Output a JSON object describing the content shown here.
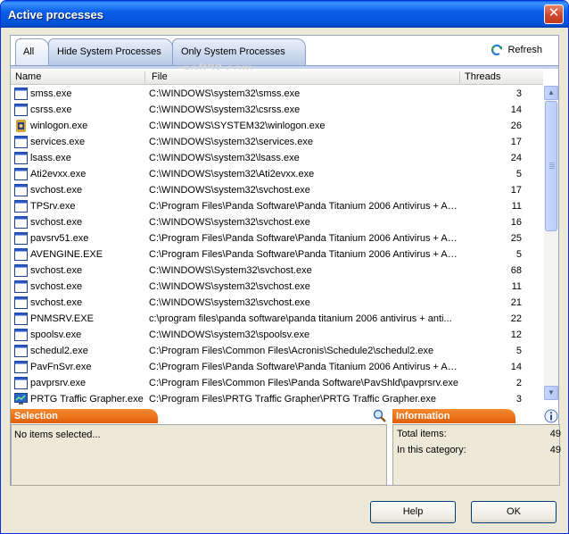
{
  "window": {
    "title": "Active processes",
    "close_glyph": "✕"
  },
  "tabs": [
    {
      "label": "All"
    },
    {
      "label": "Hide System Processes"
    },
    {
      "label": "Only System Processes"
    }
  ],
  "watermark": "soft32.com",
  "toolbar": {
    "refresh_label": "Refresh",
    "refresh_icon": "refresh-icon"
  },
  "columns": {
    "name": "Name",
    "file": "File",
    "threads": "Threads"
  },
  "processes": [
    {
      "name": "smss.exe",
      "file": "C:\\WINDOWS\\system32\\smss.exe",
      "threads": "3",
      "icon": "window-icon"
    },
    {
      "name": "csrss.exe",
      "file": "C:\\WINDOWS\\system32\\csrss.exe",
      "threads": "14",
      "icon": "window-icon"
    },
    {
      "name": "winlogon.exe",
      "file": "C:\\WINDOWS\\SYSTEM32\\winlogon.exe",
      "threads": "26",
      "icon": "winlogon-icon"
    },
    {
      "name": "services.exe",
      "file": "C:\\WINDOWS\\system32\\services.exe",
      "threads": "17",
      "icon": "window-icon"
    },
    {
      "name": "lsass.exe",
      "file": "C:\\WINDOWS\\system32\\lsass.exe",
      "threads": "24",
      "icon": "window-icon"
    },
    {
      "name": "Ati2evxx.exe",
      "file": "C:\\WINDOWS\\system32\\Ati2evxx.exe",
      "threads": "5",
      "icon": "window-icon"
    },
    {
      "name": "svchost.exe",
      "file": "C:\\WINDOWS\\system32\\svchost.exe",
      "threads": "17",
      "icon": "window-icon"
    },
    {
      "name": "TPSrv.exe",
      "file": "C:\\Program Files\\Panda Software\\Panda Titanium 2006 Antivirus + An...",
      "threads": "11",
      "icon": "window-icon"
    },
    {
      "name": "svchost.exe",
      "file": "C:\\WINDOWS\\system32\\svchost.exe",
      "threads": "16",
      "icon": "window-icon"
    },
    {
      "name": "pavsrv51.exe",
      "file": "C:\\Program Files\\Panda Software\\Panda Titanium 2006 Antivirus + An...",
      "threads": "25",
      "icon": "window-icon"
    },
    {
      "name": "AVENGINE.EXE",
      "file": "C:\\Program Files\\Panda Software\\Panda Titanium 2006 Antivirus + An...",
      "threads": "5",
      "icon": "window-icon"
    },
    {
      "name": "svchost.exe",
      "file": "C:\\WINDOWS\\System32\\svchost.exe",
      "threads": "68",
      "icon": "window-icon"
    },
    {
      "name": "svchost.exe",
      "file": "C:\\WINDOWS\\system32\\svchost.exe",
      "threads": "11",
      "icon": "window-icon"
    },
    {
      "name": "svchost.exe",
      "file": "C:\\WINDOWS\\system32\\svchost.exe",
      "threads": "21",
      "icon": "window-icon"
    },
    {
      "name": "PNMSRV.EXE",
      "file": "c:\\program files\\panda software\\panda titanium 2006 antivirus + anti...",
      "threads": "22",
      "icon": "window-icon"
    },
    {
      "name": "spoolsv.exe",
      "file": "C:\\WINDOWS\\system32\\spoolsv.exe",
      "threads": "12",
      "icon": "window-icon"
    },
    {
      "name": "schedul2.exe",
      "file": "C:\\Program Files\\Common Files\\Acronis\\Schedule2\\schedul2.exe",
      "threads": "5",
      "icon": "window-icon"
    },
    {
      "name": "PavFnSvr.exe",
      "file": "C:\\Program Files\\Panda Software\\Panda Titanium 2006 Antivirus + An...",
      "threads": "14",
      "icon": "window-icon"
    },
    {
      "name": "pavprsrv.exe",
      "file": "C:\\Program Files\\Common Files\\Panda Software\\PavShld\\pavprsrv.exe",
      "threads": "2",
      "icon": "window-icon"
    },
    {
      "name": "PRTG Traffic Grapher.exe",
      "file": "C:\\Program Files\\PRTG Traffic Grapher\\PRTG Traffic Grapher.exe",
      "threads": "3",
      "icon": "prtg-icon"
    }
  ],
  "selection": {
    "title": "Selection",
    "text": "No items selected...",
    "icon": "magnifier-icon"
  },
  "information": {
    "title": "Information",
    "icon": "info-icon",
    "total_label": "Total items:",
    "total_value": "49",
    "category_label": "In this category:",
    "category_value": "49"
  },
  "buttons": {
    "help": "Help",
    "ok": "OK"
  },
  "colors": {
    "titlebar": "#0450d6",
    "pane_header": "#e8680f",
    "tab_active": "#dfe8f6"
  }
}
